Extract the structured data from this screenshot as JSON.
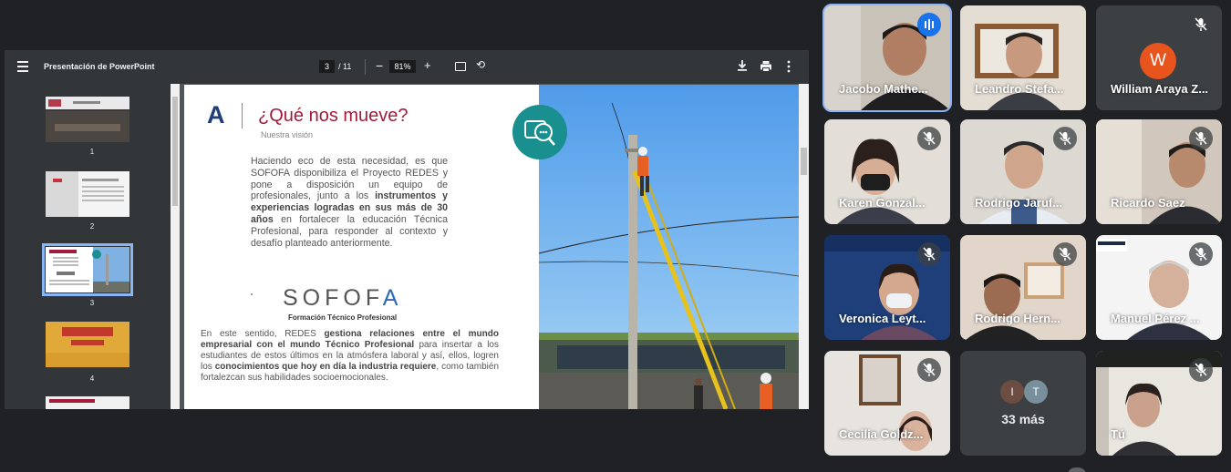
{
  "viewer": {
    "title": "Presentación de PowerPoint",
    "page_current": "3",
    "page_total": "/ 11",
    "zoom": "81%",
    "thumbnails": [
      {
        "number": "1"
      },
      {
        "number": "2"
      },
      {
        "number": "3",
        "active": true
      },
      {
        "number": "4"
      }
    ],
    "slide": {
      "logo_letter": "A",
      "heading": "¿Qué nos mueve?",
      "subheading": "Nuestra visión",
      "paragraph1_a": "Haciendo eco de esta necesidad, es que SOFOFA disponibiliza el Proyecto REDES y pone a disposición un equipo de profesionales, junto a los ",
      "paragraph1_b": "instrumentos y experiencias logradas en sus más de 30 años",
      "paragraph1_c": " en fortalecer la educación Técnica Profesional, para responder al contexto y desafío planteado anteriormente.",
      "brand_name": "SOFOF",
      "brand_last": "A",
      "brand_caption": "Formación Técnico Profesional",
      "paragraph2_a": "En este sentido, REDES ",
      "paragraph2_b": "gestiona relaciones entre el mundo empresarial con el mundo Técnico Profesional",
      "paragraph2_c": " para insertar a los estudiantes de estos últimos en la atmósfera laboral y así, ellos, logren los ",
      "paragraph2_d": "conocimientos que hoy en día la industria requiere",
      "paragraph2_e": ", como también fortalezcan sus habilidades socioemocionales."
    }
  },
  "participants": [
    {
      "name": "Jacobo Mathe...",
      "state": "speaking"
    },
    {
      "name": "Leandro Stefa...",
      "state": "video"
    },
    {
      "name": "William Araya Z...",
      "state": "muted",
      "avatar_letter": "W"
    },
    {
      "name": "Karen Gonzal...",
      "state": "muted"
    },
    {
      "name": "Rodrigo Jaruf...",
      "state": "muted"
    },
    {
      "name": "Ricardo Saez",
      "state": "muted"
    },
    {
      "name": "Veronica Leyt...",
      "state": "muted"
    },
    {
      "name": "Rodrigo Hern...",
      "state": "muted"
    },
    {
      "name": "Manuel Pérez ...",
      "state": "muted"
    },
    {
      "name": "Cecilia Goldz...",
      "state": "muted"
    },
    {
      "name": "Tú",
      "state": "muted"
    }
  ],
  "overflow": {
    "label": "33 más",
    "avatars": [
      "I",
      "T"
    ]
  },
  "colors": {
    "background": "#202124",
    "tile": "#3c4043",
    "speaking_outline": "#8ab4f8",
    "brand_red": "#a01c3a",
    "brand_blue": "#1f3f7a"
  }
}
